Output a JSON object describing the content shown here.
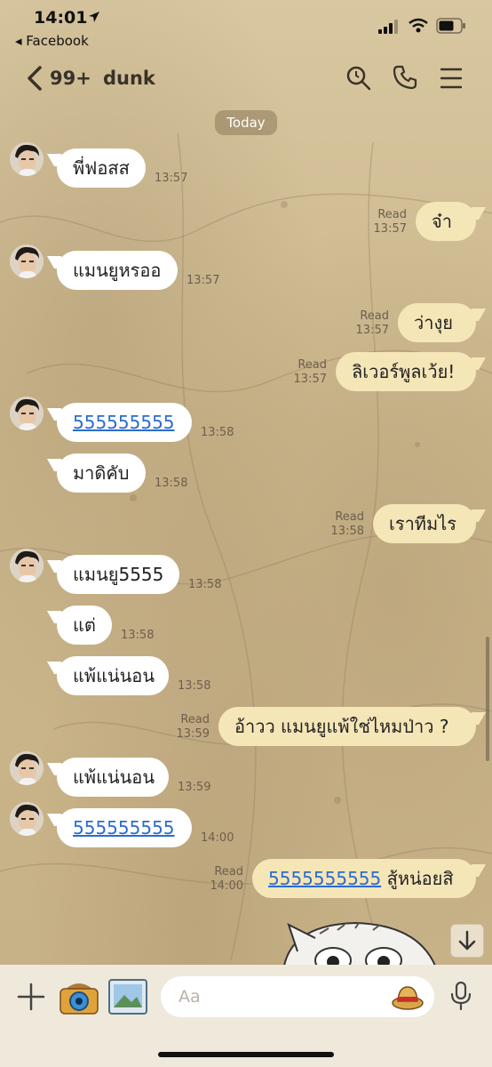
{
  "status_bar": {
    "time": "14:01",
    "back_app": "◂ Facebook"
  },
  "header": {
    "unread_count": "99+",
    "contact_name": "dunk"
  },
  "date_divider": "Today",
  "messages": [
    {
      "dir": "in",
      "text": "พี่ฟอสส",
      "time": "13:57",
      "avatar": true
    },
    {
      "dir": "out",
      "text": "จ๋า",
      "read": "Read",
      "time": "13:57"
    },
    {
      "dir": "in",
      "text": "แมนยูหรออ",
      "time": "13:57",
      "avatar": true
    },
    {
      "dir": "out",
      "text": "ว่างุย",
      "read": "Read",
      "time": "13:57"
    },
    {
      "dir": "out",
      "text": "ลิเวอร์พูลเว้ย!",
      "read": "Read",
      "time": "13:57"
    },
    {
      "dir": "in",
      "text": "555555555",
      "time": "13:58",
      "avatar": true,
      "link": true
    },
    {
      "dir": "in",
      "text": "มาดิคับ",
      "time": "13:58"
    },
    {
      "dir": "out",
      "text": "เราทีมไร",
      "read": "Read",
      "time": "13:58"
    },
    {
      "dir": "in",
      "text": "แมนยู5555",
      "time": "13:58",
      "avatar": true
    },
    {
      "dir": "in",
      "text": "แต่",
      "time": "13:58"
    },
    {
      "dir": "in",
      "text": "แพ้แน่นอน",
      "time": "13:58"
    },
    {
      "dir": "out",
      "text": "อ้าวว แมนยูแพ้ใช่ไหมป่าว ?",
      "read": "Read",
      "time": "13:59"
    },
    {
      "dir": "in",
      "text": "แพ้แน่นอน",
      "time": "13:59",
      "avatar": true
    },
    {
      "dir": "in",
      "text": "555555555",
      "time": "14:00",
      "avatar": true,
      "link": true
    },
    {
      "dir": "out",
      "link_text": "5555555555",
      "text": " สู้หน่อยสิ",
      "read": "Read",
      "time": "14:00"
    }
  ],
  "composer": {
    "placeholder": "Aa"
  },
  "colors": {
    "bubble_in": "#ffffff",
    "bubble_out": "#f5e6b8",
    "link": "#2b6bd0"
  }
}
